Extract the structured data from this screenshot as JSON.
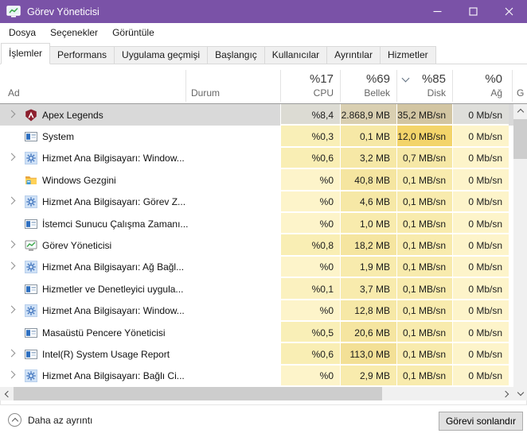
{
  "window": {
    "title": "Görev Yöneticisi"
  },
  "colors": {
    "titlebar": "#7a52a7",
    "selected_row": "#d9d9d9",
    "scroll_track": "#f0f0f0",
    "scroll_thumb": "#cdcdcd",
    "button_bg": "#e1e1e1",
    "button_border": "#adadad"
  },
  "menu": {
    "items": [
      "Dosya",
      "Seçenekler",
      "Görüntüle"
    ]
  },
  "tabs": [
    {
      "label": "İşlemler",
      "active": true
    },
    {
      "label": "Performans",
      "active": false
    },
    {
      "label": "Uygulama geçmişi",
      "active": false
    },
    {
      "label": "Başlangıç",
      "active": false
    },
    {
      "label": "Kullanıcılar",
      "active": false
    },
    {
      "label": "Ayrıntılar",
      "active": false
    },
    {
      "label": "Hizmetler",
      "active": false
    }
  ],
  "table": {
    "columns": {
      "name_label": "Ad",
      "status_label": "Durum",
      "gpu_partial": "G",
      "stats": [
        {
          "pct": "%17",
          "label": "CPU",
          "sorted": false
        },
        {
          "pct": "%69",
          "label": "Bellek",
          "sorted": false
        },
        {
          "pct": "%85",
          "label": "Disk",
          "sorted": true
        },
        {
          "pct": "%0",
          "label": "Ağ",
          "sorted": false
        }
      ]
    },
    "rows": [
      {
        "name": "Apex Legends",
        "icon": "apex",
        "expandable": true,
        "selected": true,
        "values": [
          "%8,4",
          "2.868,9 MB",
          "35,2 MB/sn",
          "0 Mb/sn"
        ],
        "heat": [
          "#dcdbd3",
          "#d9cfb1",
          "#d2c5a2",
          "#dededa"
        ]
      },
      {
        "name": "System",
        "icon": "system",
        "expandable": false,
        "selected": false,
        "values": [
          "%0,3",
          "0,1 MB",
          "12,0 MB/sn",
          "0 Mb/sn"
        ],
        "heat": [
          "#f9efb7",
          "#f6e8a6",
          "#f3d46a",
          "#fdf4ca"
        ]
      },
      {
        "name": "Hizmet Ana Bilgisayarı: Window...",
        "icon": "service",
        "expandable": true,
        "selected": false,
        "values": [
          "%0,6",
          "3,2 MB",
          "0,7 MB/sn",
          "0 Mb/sn"
        ],
        "heat": [
          "#f9eeb4",
          "#f6e8a6",
          "#f6e8a6",
          "#fdf4ca"
        ]
      },
      {
        "name": "Windows Gezgini",
        "icon": "folder",
        "expandable": false,
        "selected": false,
        "values": [
          "%0",
          "40,8 MB",
          "0,1 MB/sn",
          "0 Mb/sn"
        ],
        "heat": [
          "#fdf4ca",
          "#f5e5a0",
          "#f8ebad",
          "#fdf4ca"
        ]
      },
      {
        "name": "Hizmet Ana Bilgisayarı: Görev Z...",
        "icon": "service",
        "expandable": true,
        "selected": false,
        "values": [
          "%0",
          "4,6 MB",
          "0,1 MB/sn",
          "0 Mb/sn"
        ],
        "heat": [
          "#fdf4ca",
          "#f6e8a6",
          "#f8ebad",
          "#fdf4ca"
        ]
      },
      {
        "name": "İstemci Sunucu Çalışma Zamanı...",
        "icon": "system",
        "expandable": false,
        "selected": false,
        "values": [
          "%0",
          "1,0 MB",
          "0,1 MB/sn",
          "0 Mb/sn"
        ],
        "heat": [
          "#fdf4ca",
          "#f8ebad",
          "#f8ebad",
          "#fdf4ca"
        ]
      },
      {
        "name": "Görev Yöneticisi",
        "icon": "taskmgr",
        "expandable": true,
        "selected": false,
        "values": [
          "%0,8",
          "18,2 MB",
          "0,1 MB/sn",
          "0 Mb/sn"
        ],
        "heat": [
          "#f9eeb4",
          "#f5e5a0",
          "#f8ebad",
          "#fdf4ca"
        ]
      },
      {
        "name": "Hizmet Ana Bilgisayarı: Ağ Bağl...",
        "icon": "service",
        "expandable": true,
        "selected": false,
        "values": [
          "%0",
          "1,9 MB",
          "0,1 MB/sn",
          "0 Mb/sn"
        ],
        "heat": [
          "#fdf4ca",
          "#f8ebad",
          "#f8ebad",
          "#fdf4ca"
        ]
      },
      {
        "name": "Hizmetler ve Denetleyici uygula...",
        "icon": "system",
        "expandable": false,
        "selected": false,
        "values": [
          "%0,1",
          "3,7 MB",
          "0,1 MB/sn",
          "0 Mb/sn"
        ],
        "heat": [
          "#fbf1bf",
          "#f8ebad",
          "#f8ebad",
          "#fdf4ca"
        ]
      },
      {
        "name": "Hizmet Ana Bilgisayarı: Window...",
        "icon": "service",
        "expandable": true,
        "selected": false,
        "values": [
          "%0",
          "12,8 MB",
          "0,1 MB/sn",
          "0 Mb/sn"
        ],
        "heat": [
          "#fdf4ca",
          "#f6e8a6",
          "#f8ebad",
          "#fdf4ca"
        ]
      },
      {
        "name": "Masaüstü Pencere Yöneticisi",
        "icon": "system",
        "expandable": false,
        "selected": false,
        "values": [
          "%0,5",
          "20,6 MB",
          "0,1 MB/sn",
          "0 Mb/sn"
        ],
        "heat": [
          "#f9efb7",
          "#f5e5a0",
          "#f8ebad",
          "#fdf4ca"
        ]
      },
      {
        "name": "Intel(R) System Usage Report",
        "icon": "system",
        "expandable": true,
        "selected": false,
        "values": [
          "%0,6",
          "113,0 MB",
          "0,1 MB/sn",
          "0 Mb/sn"
        ],
        "heat": [
          "#f9eeb4",
          "#f3e096",
          "#f8ebad",
          "#fdf4ca"
        ]
      },
      {
        "name": "Hizmet Ana Bilgisayarı: Bağlı Ci...",
        "icon": "service",
        "expandable": true,
        "selected": false,
        "values": [
          "%0",
          "2,9 MB",
          "0,1 MB/sn",
          "0 Mb/sn"
        ],
        "heat": [
          "#fdf4ca",
          "#f8ebad",
          "#f8ebad",
          "#fdf4ca"
        ]
      }
    ]
  },
  "statusbar": {
    "less_details": "Daha az ayrıntı",
    "end_task": "Görevi sonlandır"
  }
}
